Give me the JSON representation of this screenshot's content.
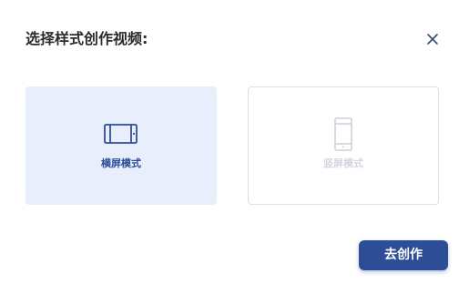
{
  "dialog": {
    "title": "选择样式创作视频:",
    "close_icon": "close-icon"
  },
  "options": [
    {
      "label": "横屏模式",
      "icon": "landscape-screen-icon",
      "selected": true,
      "color": "#2d4e96",
      "background": "#e8eefb"
    },
    {
      "label": "竖屏模式",
      "icon": "portrait-phone-icon",
      "selected": false,
      "color": "#d3d7de",
      "background": "#ffffff"
    }
  ],
  "actions": {
    "primary_label": "去创作",
    "primary_color": "#2d4e96"
  }
}
